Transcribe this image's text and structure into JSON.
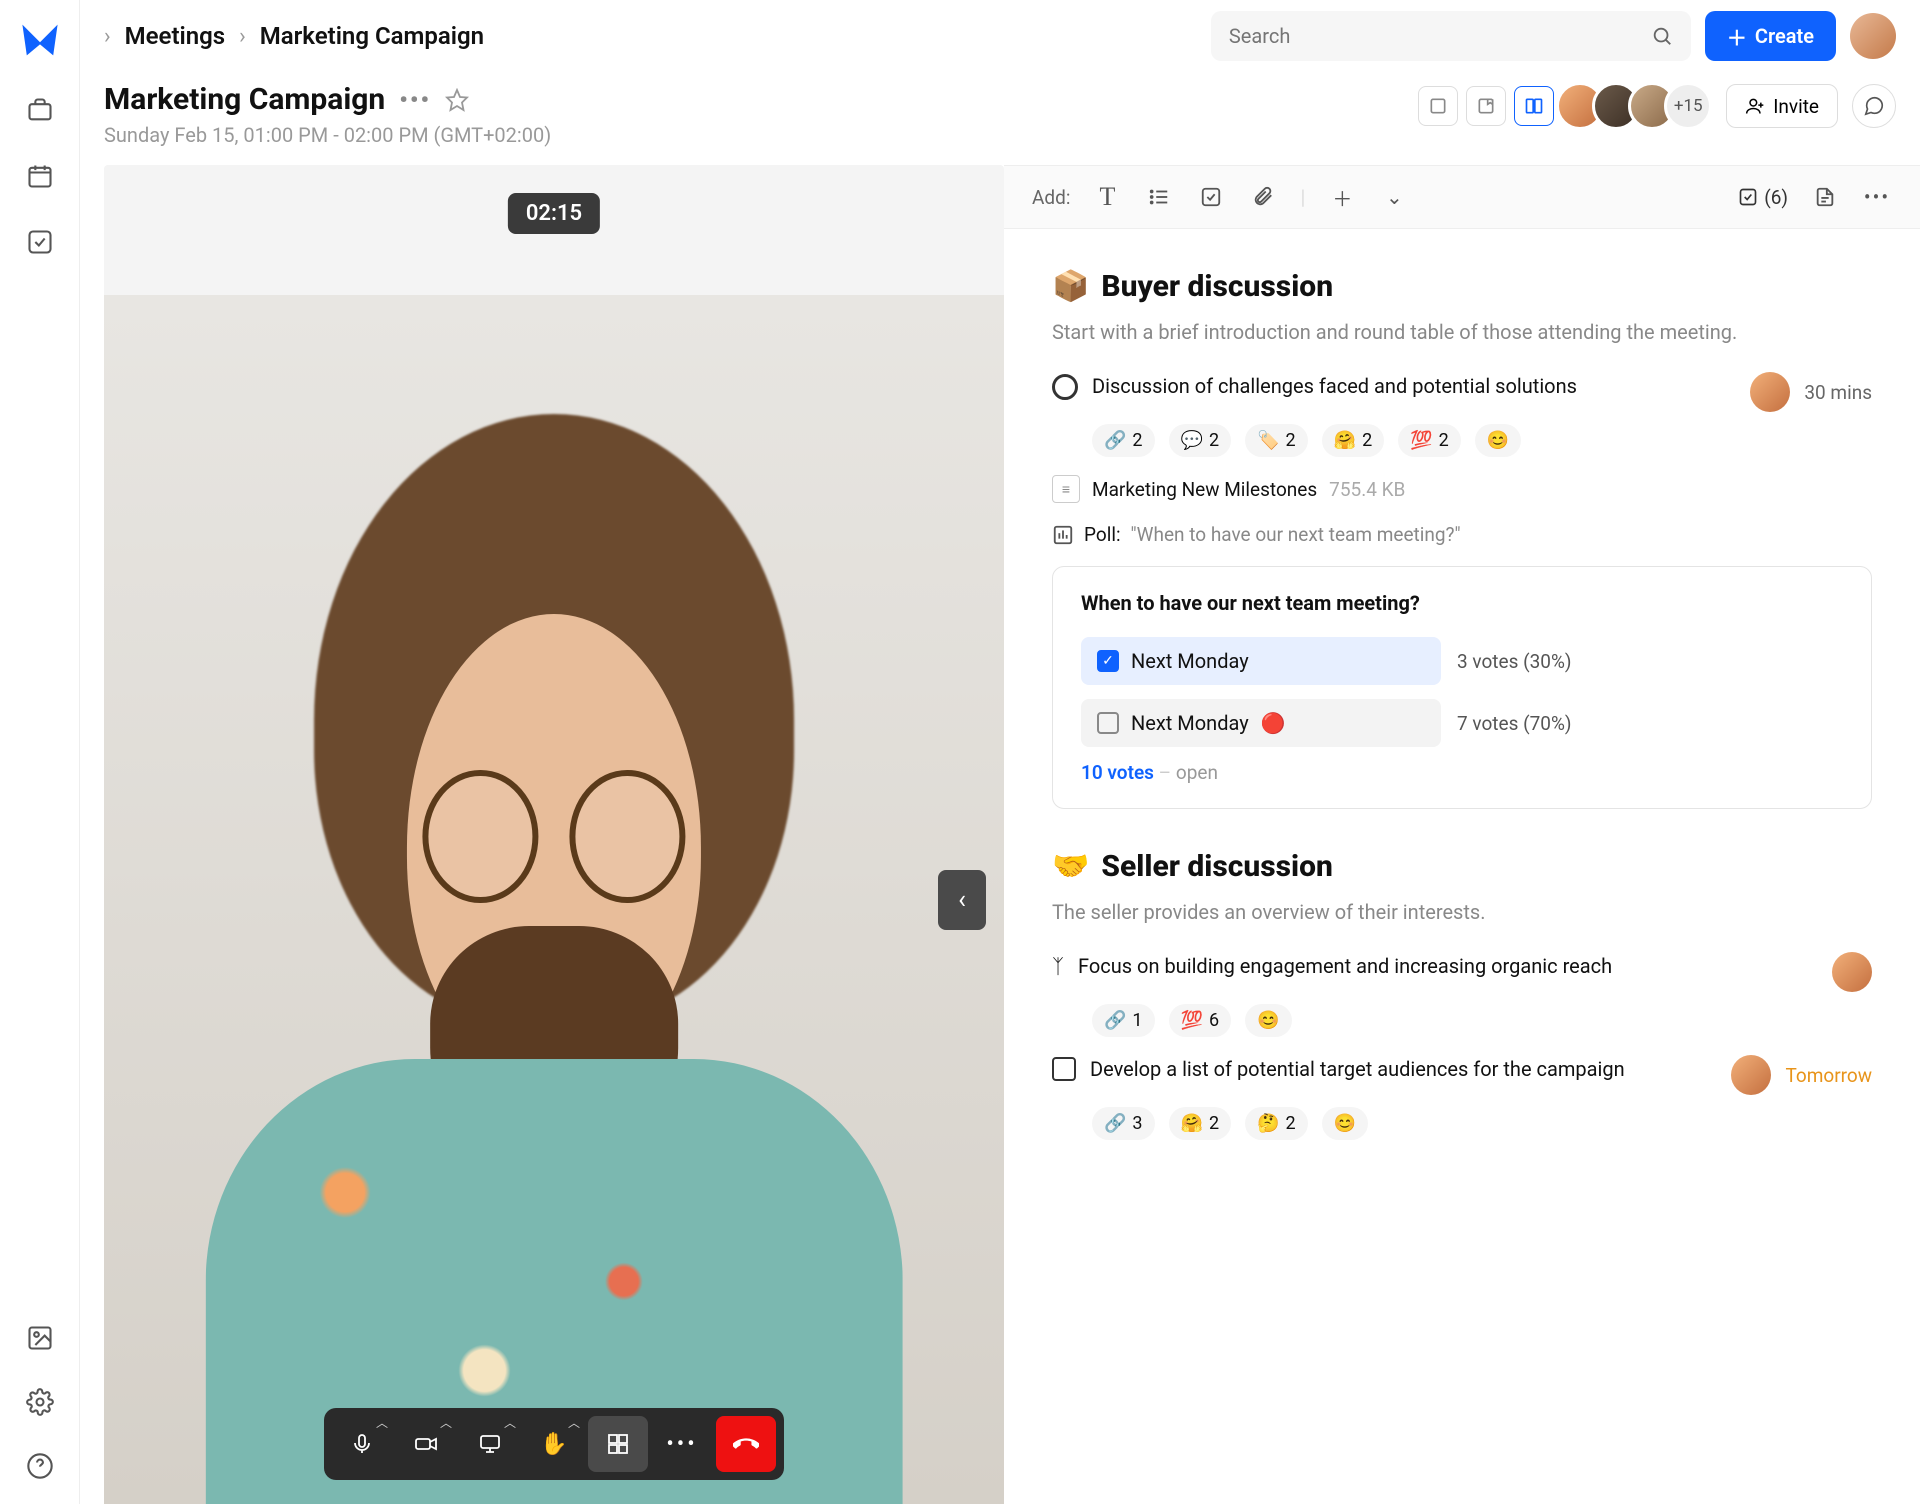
{
  "breadcrumb": {
    "level1": "Meetings",
    "level2": "Marketing Campaign"
  },
  "search": {
    "placeholder": "Search"
  },
  "create_button": "Create",
  "page": {
    "title": "Marketing Campaign",
    "subtitle": "Sunday Feb 15, 01:00 PM - 02:00 PM (GMT+02:00)",
    "more_participants": "+15",
    "invite_label": "Invite"
  },
  "video": {
    "timer": "02:15"
  },
  "notes": {
    "add_label": "Add:",
    "task_count": "(6)",
    "sections": [
      {
        "emoji": "📦",
        "title": "Buyer discussion",
        "desc": "Start with a brief introduction and round table of those attending the meeting.",
        "items": [
          {
            "type": "circle",
            "text": "Discussion of challenges faced and potential solutions",
            "duration": "30 mins",
            "reactions": [
              {
                "icon": "🔗",
                "count": "2"
              },
              {
                "icon": "💬",
                "count": "2"
              },
              {
                "icon": "🏷️",
                "count": "2"
              },
              {
                "icon": "🤗",
                "count": "2"
              },
              {
                "icon": "💯",
                "count": "2"
              },
              {
                "icon": "😊",
                "count": ""
              }
            ]
          }
        ],
        "file": {
          "name": "Marketing New Milestones",
          "size": "755.4 KB"
        },
        "poll_intro": {
          "label": "Poll:",
          "question": "\"When to have our next team meeting?\""
        },
        "poll": {
          "question": "When to have our next team meeting?",
          "options": [
            {
              "label": "Next Monday",
              "selected": true,
              "badge": "",
              "result": "3 votes (30%)"
            },
            {
              "label": "Next Monday",
              "selected": false,
              "badge": "🔴",
              "result": "7 votes (70%)"
            }
          ],
          "total_votes": "10 votes",
          "status": "open"
        }
      },
      {
        "emoji": "🤝",
        "title": "Seller discussion",
        "desc": "The seller provides an overview of their interests.",
        "items": [
          {
            "type": "branch",
            "text": "Focus on building engagement and increasing organic reach",
            "reactions": [
              {
                "icon": "🔗",
                "count": "1"
              },
              {
                "icon": "💯",
                "count": "6"
              },
              {
                "icon": "😊",
                "count": ""
              }
            ]
          },
          {
            "type": "square",
            "text": "Develop a list of potential target audiences for the campaign",
            "due": "Tomorrow",
            "reactions": [
              {
                "icon": "🔗",
                "count": "3"
              },
              {
                "icon": "🤗",
                "count": "2"
              },
              {
                "icon": "🤔",
                "count": "2"
              },
              {
                "icon": "😊",
                "count": ""
              }
            ]
          }
        ]
      }
    ]
  }
}
